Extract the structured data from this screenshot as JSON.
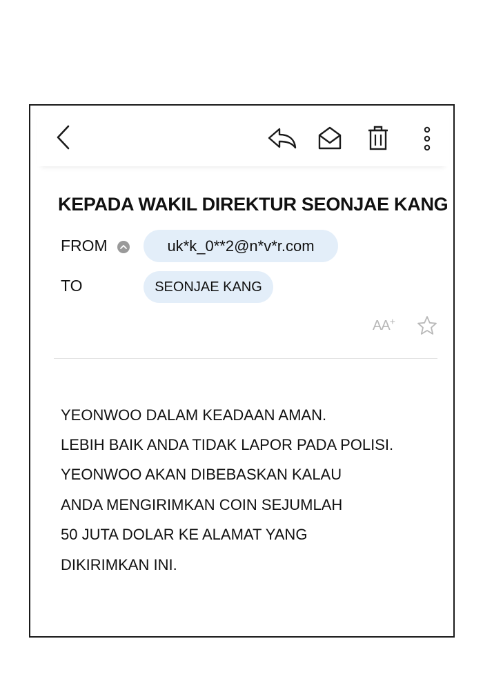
{
  "email": {
    "subject": "KEPADA WAKIL DIREKTUR SEONJAE KANG",
    "from_label": "FROM",
    "from_address": "uk*k_0**2@n*v*r.com",
    "to_label": "TO",
    "to_name": "SEONJAE KANG",
    "font_size_label": "AA+",
    "body_lines": [
      "YEONWOO DALAM KEADAAN AMAN.",
      "LEBIH BAIK ANDA TIDAK LAPOR PADA POLISI.",
      "YEONWOO AKAN DIBEBASKAN KALAU",
      "ANDA MENGIRIMKAN COIN SEJUMLAH",
      "50 JUTA DOLAR KE ALAMAT YANG",
      "DIKIRIMKAN INI."
    ]
  },
  "toolbar": {
    "icons": [
      "back-icon",
      "reply-icon",
      "mark-read-icon",
      "delete-icon",
      "more-icon"
    ]
  },
  "colors": {
    "chip_background": "#e3eef9",
    "muted_icon": "#b8b8b8",
    "frame_border": "#1a1a1a"
  }
}
